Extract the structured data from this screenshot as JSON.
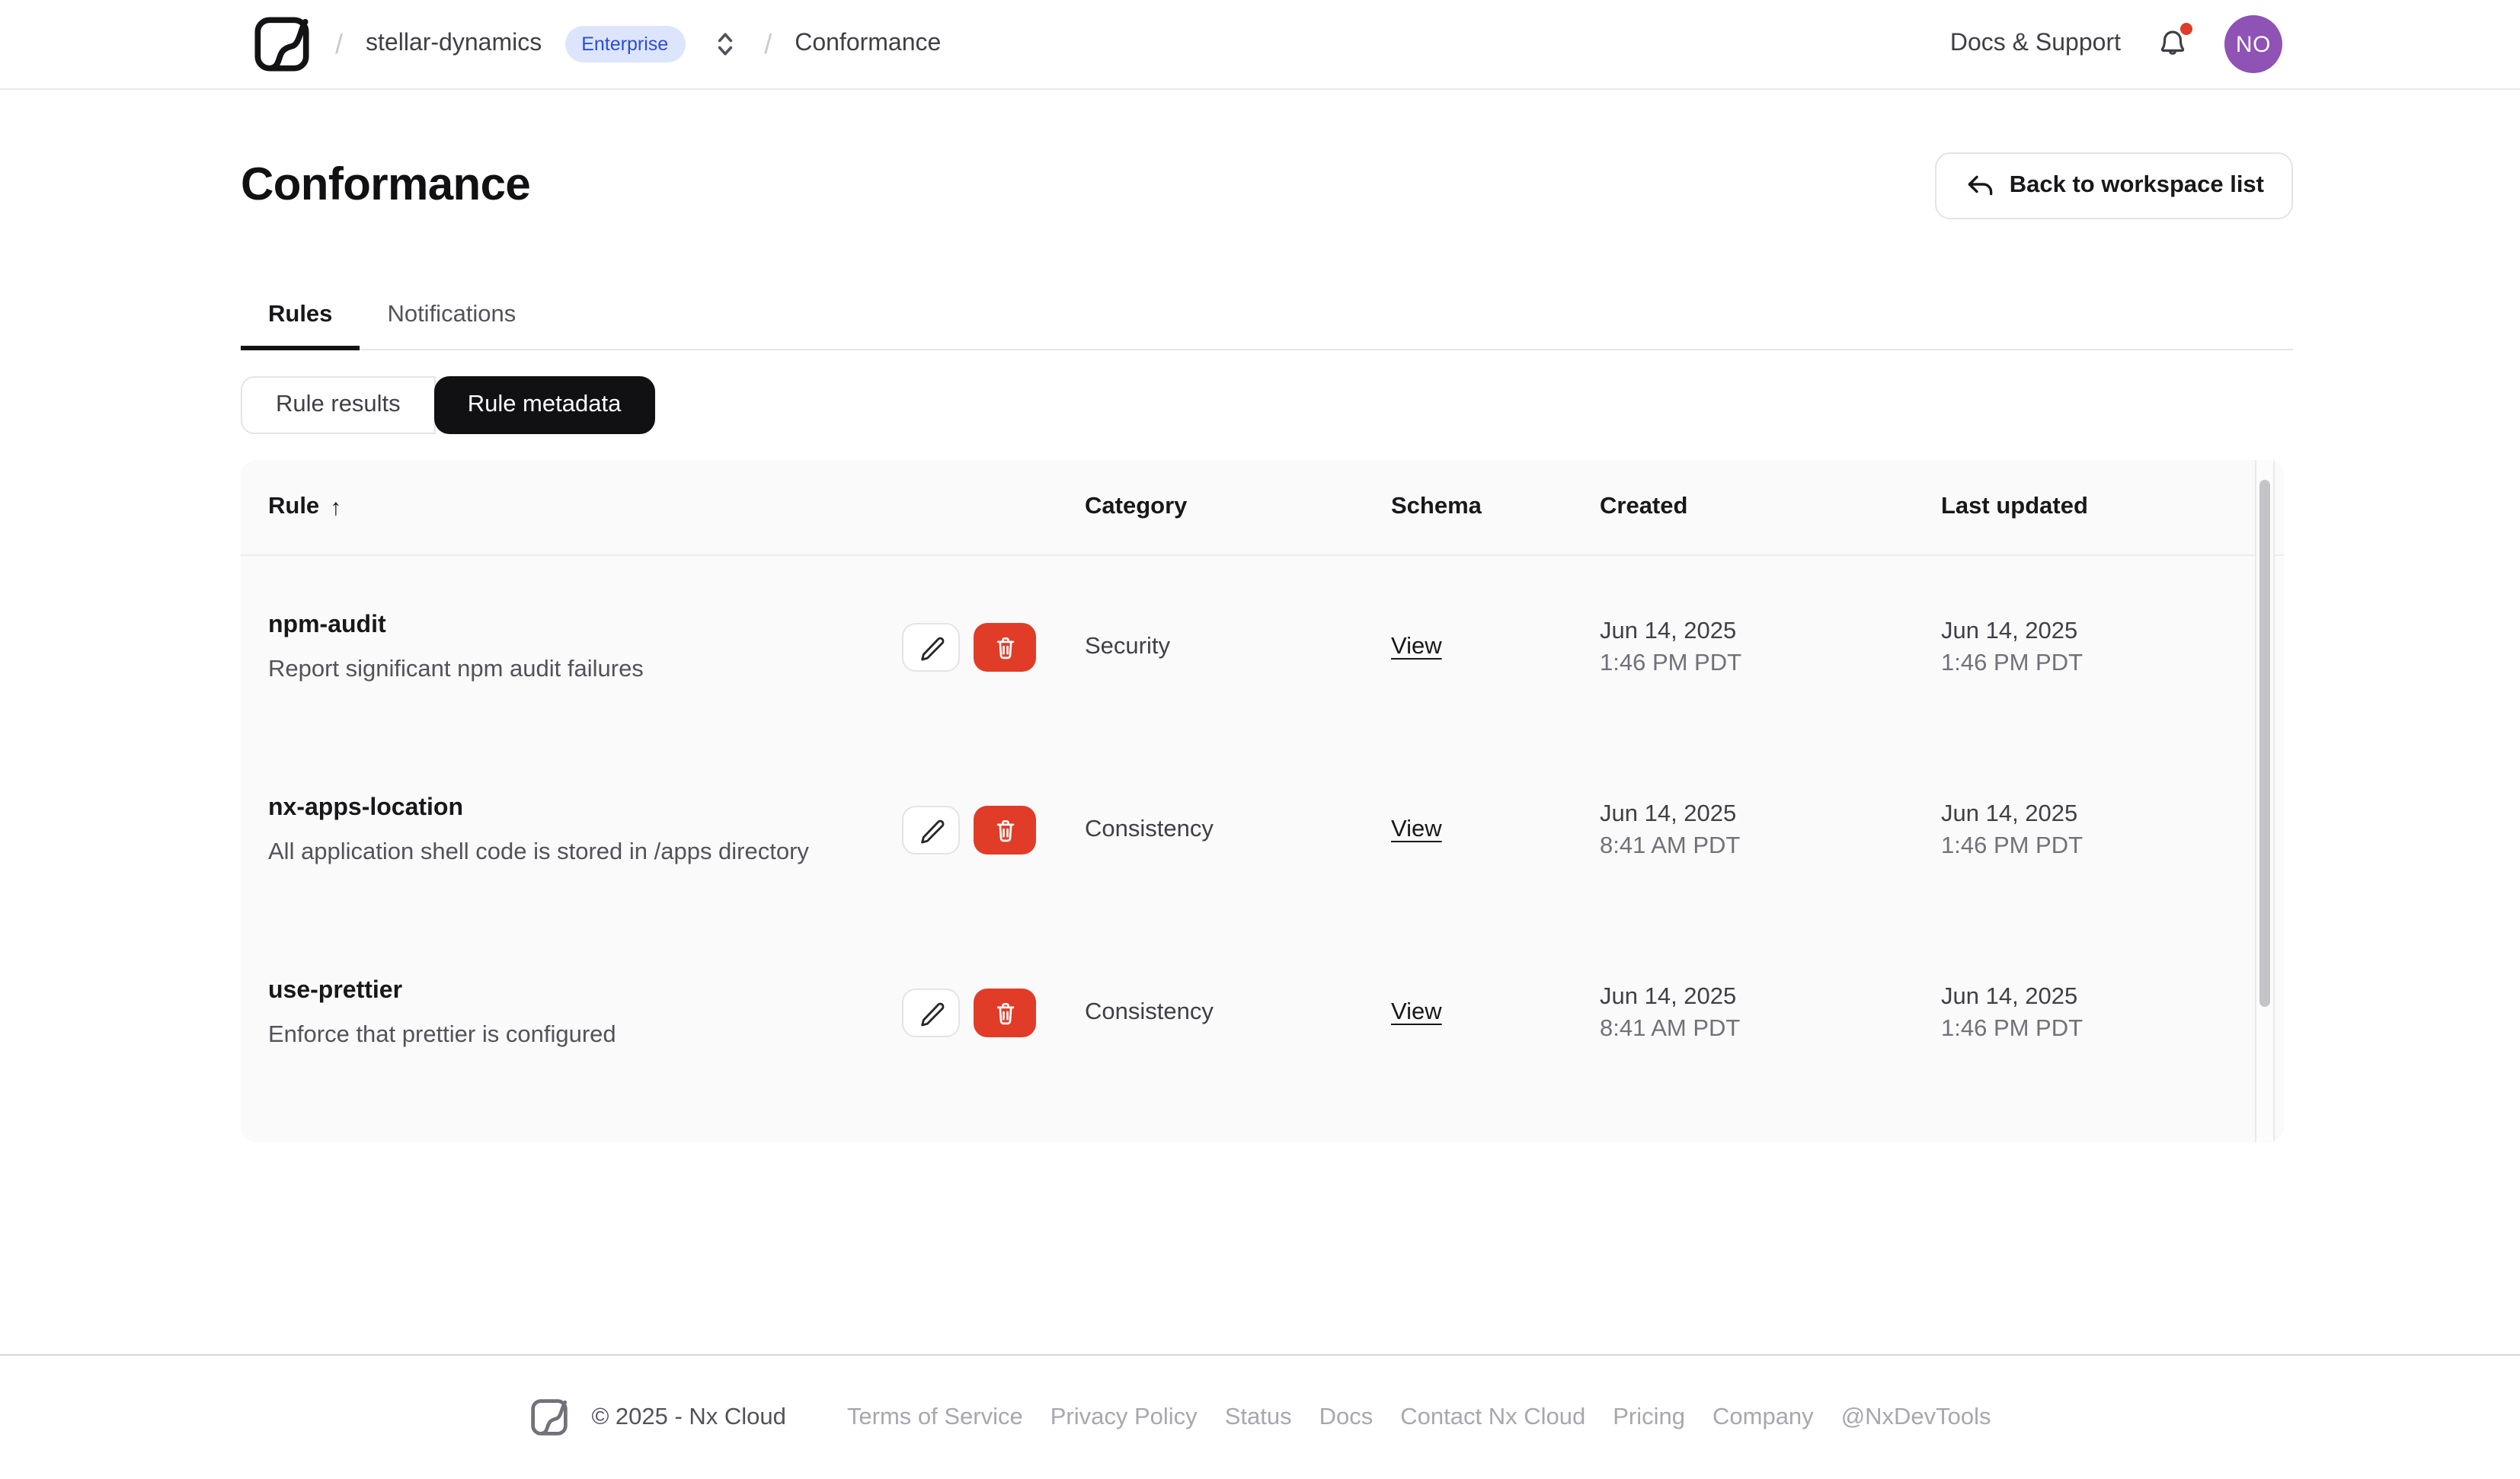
{
  "header": {
    "breadcrumb": {
      "separator": "/",
      "workspace": "stellar-dynamics",
      "plan_badge": "Enterprise",
      "page": "Conformance"
    },
    "docs_support": "Docs & Support",
    "avatar_initials": "NO"
  },
  "page": {
    "title": "Conformance",
    "back_button_label": "Back to workspace list"
  },
  "tabs": [
    {
      "label": "Rules",
      "active": true
    },
    {
      "label": "Notifications",
      "active": false
    }
  ],
  "segmented_control": [
    {
      "label": "Rule results",
      "active": false
    },
    {
      "label": "Rule metadata",
      "active": true
    }
  ],
  "table": {
    "columns": [
      "Rule",
      "Category",
      "Schema",
      "Created",
      "Last updated"
    ],
    "sort_indicator": "↑",
    "rows": [
      {
        "name": "npm-audit",
        "description": "Report significant npm audit failures",
        "category": "Security",
        "schema_link": "View",
        "created_date": "Jun 14, 2025",
        "created_time": "1:46 PM PDT",
        "updated_date": "Jun 14, 2025",
        "updated_time": "1:46 PM PDT"
      },
      {
        "name": "nx-apps-location",
        "description": "All application shell code is stored in /apps directory",
        "category": "Consistency",
        "schema_link": "View",
        "created_date": "Jun 14, 2025",
        "created_time": "8:41 AM PDT",
        "updated_date": "Jun 14, 2025",
        "updated_time": "1:46 PM PDT"
      },
      {
        "name": "use-prettier",
        "description": "Enforce that prettier is configured",
        "category": "Consistency",
        "schema_link": "View",
        "created_date": "Jun 14, 2025",
        "created_time": "8:41 AM PDT",
        "updated_date": "Jun 14, 2025",
        "updated_time": "1:46 PM PDT"
      }
    ]
  },
  "footer": {
    "copyright": "© 2025 - Nx Cloud",
    "links": [
      "Terms of Service",
      "Privacy Policy",
      "Status",
      "Docs",
      "Contact Nx Cloud",
      "Pricing",
      "Company",
      "@NxDevTools"
    ]
  },
  "icons": [
    "nx-logo-icon",
    "workspace-switcher-icon",
    "bell-icon",
    "undo-arrow-icon",
    "pencil-icon",
    "trash-icon",
    "sort-up-arrow"
  ],
  "colors": {
    "badge_bg": "#dce5fc",
    "badge_text": "#2b4ce0",
    "avatar_bg": "#8f52b5",
    "delete_red": "#e03c28",
    "notification_dot": "#e03c28",
    "table_bg": "#fafafa",
    "active_segment_bg": "#111113",
    "muted_text": "#71717a",
    "footer_link": "#a7a7ae"
  }
}
